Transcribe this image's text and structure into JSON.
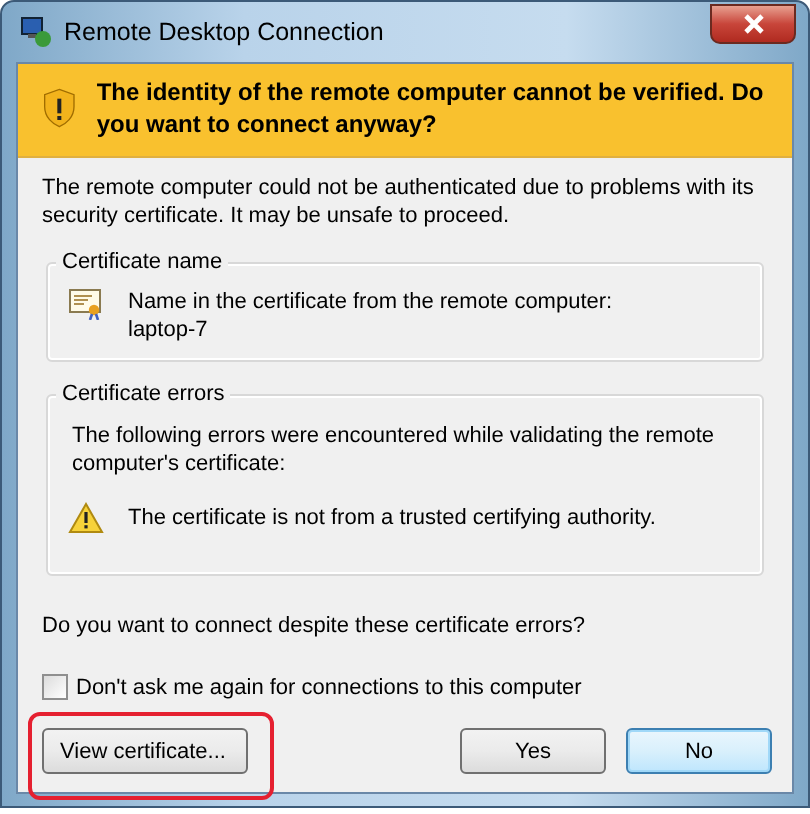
{
  "window": {
    "title": "Remote Desktop Connection"
  },
  "banner": {
    "text": "The identity of the remote computer cannot be verified. Do you want to connect anyway?"
  },
  "intro": "The remote computer could not be authenticated due to problems with its security certificate. It may be unsafe to proceed.",
  "groups": [
    {
      "kind": "name",
      "title": "Certificate name",
      "lines": [
        "Name in the certificate from the remote computer:",
        "laptop-7"
      ]
    },
    {
      "kind": "errors",
      "title": "Certificate errors",
      "description": "The following errors were encountered while validating the remote computer's certificate:",
      "errors": [
        "The certificate is not from a trusted certifying authority."
      ]
    }
  ],
  "question": "Do you want to connect despite these certificate errors?",
  "checkbox": {
    "label": "Don't ask me again for connections to this computer",
    "checked": false
  },
  "buttons": [
    {
      "label": "View certificate...",
      "kind": "left",
      "highlighted": true,
      "default": false
    },
    {
      "label": "Yes",
      "kind": "right",
      "highlighted": false,
      "default": false
    },
    {
      "label": "No",
      "kind": "right",
      "highlighted": false,
      "default": true
    }
  ]
}
